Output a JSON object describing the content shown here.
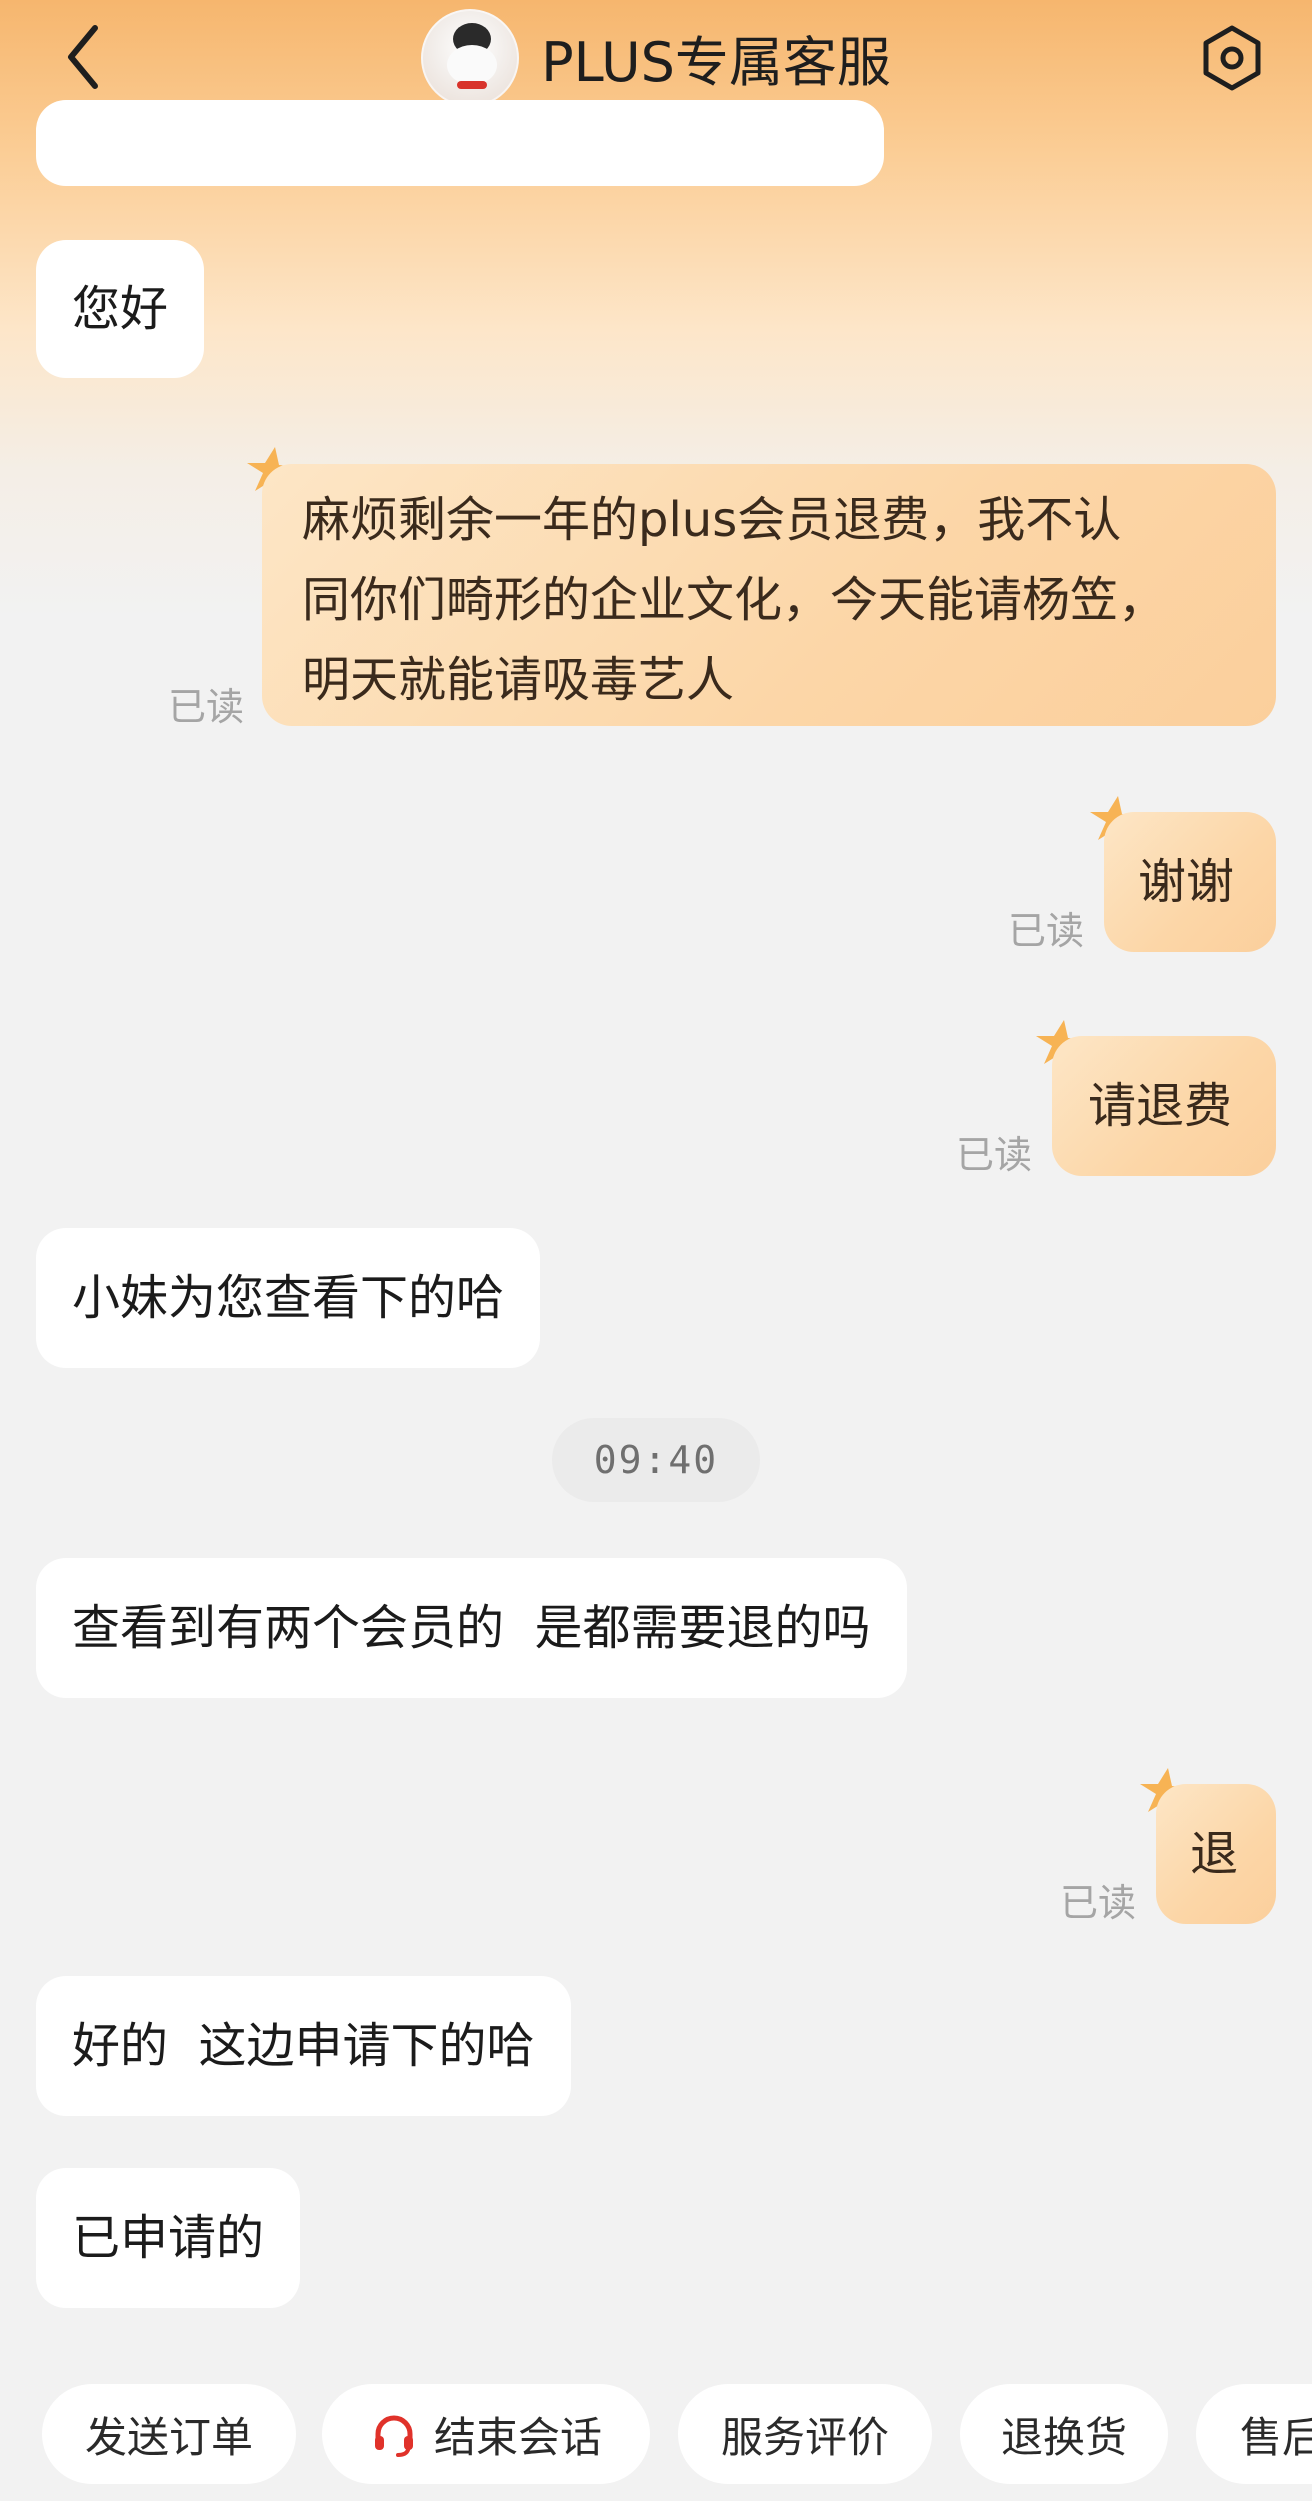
{
  "header": {
    "title": "PLUS专属客服"
  },
  "messages": [
    {
      "type": "incoming",
      "text": "您好"
    },
    {
      "type": "outgoing",
      "lines": [
        "麻烦剩余一年的plus会员退费，我不认",
        "同你们畸形的企业文化，今天能请杨笠，",
        "明天就能请吸毒艺人"
      ],
      "status": "已读"
    },
    {
      "type": "outgoing",
      "text": "谢谢",
      "status": "已读"
    },
    {
      "type": "outgoing",
      "text": "请退费",
      "status": "已读"
    },
    {
      "type": "incoming",
      "text": "小妹为您查看下的哈"
    },
    {
      "type": "incoming",
      "text": "查看到有两个会员的  是都需要退的吗"
    },
    {
      "type": "outgoing",
      "text": "退",
      "status": "已读"
    },
    {
      "type": "incoming",
      "text": "好的  这边申请下的哈"
    },
    {
      "type": "incoming",
      "text": "已申请的"
    }
  ],
  "timestamp": "09:40",
  "quick_actions": [
    {
      "label": "发送订单"
    },
    {
      "label": "结束会话",
      "icon": "headset-icon"
    },
    {
      "label": "服务评价"
    },
    {
      "label": "退换货"
    },
    {
      "label": "售后"
    }
  ],
  "colors": {
    "header_gradient_top": "#f6b66e",
    "outgoing_bubble": "#fcd6a7",
    "incoming_bubble": "#ffffff",
    "background": "#f2f2f2",
    "headset_icon": "#e0322a"
  }
}
